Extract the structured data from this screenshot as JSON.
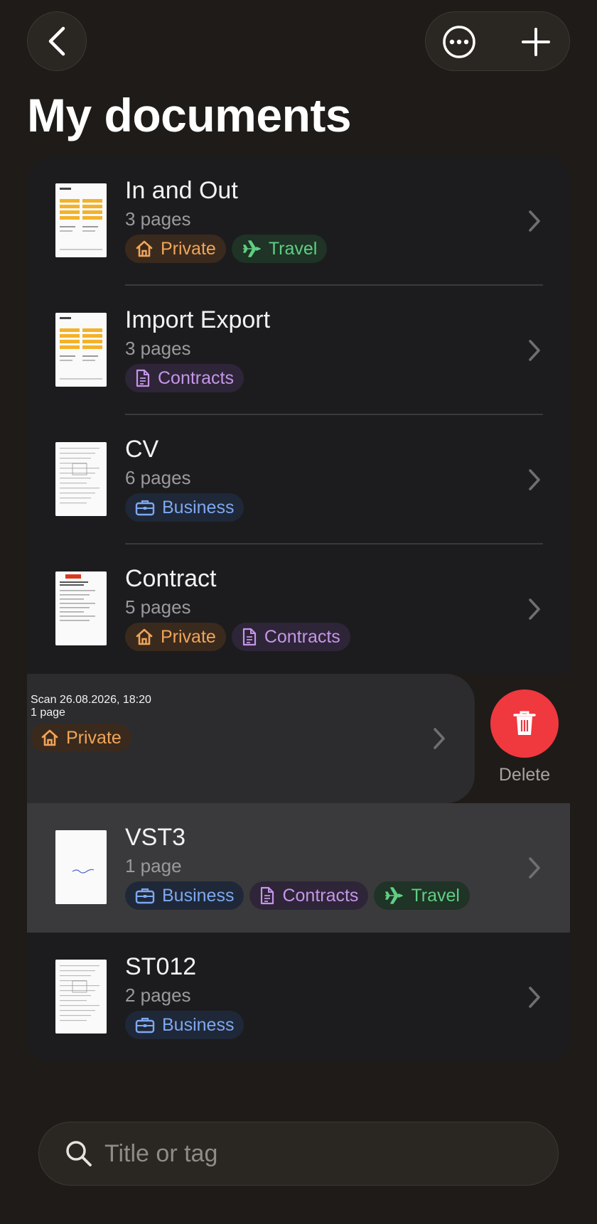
{
  "header": {
    "title": "My documents"
  },
  "documents": [
    {
      "title": "In and Out",
      "pages": "3 pages",
      "tags": [
        {
          "label": "Private",
          "kind": "private",
          "icon": "house-icon"
        },
        {
          "label": "Travel",
          "kind": "travel",
          "icon": "airplane-icon"
        }
      ]
    },
    {
      "title": "Import Export",
      "pages": "3 pages",
      "tags": [
        {
          "label": "Contracts",
          "kind": "contracts",
          "icon": "document-icon"
        }
      ]
    },
    {
      "title": "CV",
      "pages": "6 pages",
      "tags": [
        {
          "label": "Business",
          "kind": "business",
          "icon": "briefcase-icon"
        }
      ]
    },
    {
      "title": "Contract",
      "pages": "5 pages",
      "tags": [
        {
          "label": "Private",
          "kind": "private",
          "icon": "house-icon"
        },
        {
          "label": "Contracts",
          "kind": "contracts",
          "icon": "document-icon"
        }
      ]
    },
    {
      "title": "Scan 26.08.2026, 18:20",
      "pages": "1 page",
      "tags": [
        {
          "label": "Private",
          "kind": "private",
          "icon": "house-icon"
        }
      ],
      "swiped": true
    },
    {
      "title": "VST3",
      "pages": "1 page",
      "tags": [
        {
          "label": "Business",
          "kind": "business",
          "icon": "briefcase-icon"
        },
        {
          "label": "Contracts",
          "kind": "contracts",
          "icon": "document-icon"
        },
        {
          "label": "Travel",
          "kind": "travel",
          "icon": "airplane-icon"
        }
      ],
      "highlighted": true
    },
    {
      "title": "ST012",
      "pages": "2 pages",
      "tags": [
        {
          "label": "Business",
          "kind": "business",
          "icon": "briefcase-icon"
        }
      ]
    }
  ],
  "swipe_action": {
    "label": "Delete",
    "icon": "trash-icon",
    "color": "#f0383f"
  },
  "search": {
    "placeholder": "Title or tag",
    "value": ""
  },
  "colors": {
    "background": "#1e1b18",
    "list": "#1c1c1e",
    "private": "#f0a55a",
    "travel": "#5fcf82",
    "contracts": "#c596e8",
    "business": "#7ea8f0"
  }
}
